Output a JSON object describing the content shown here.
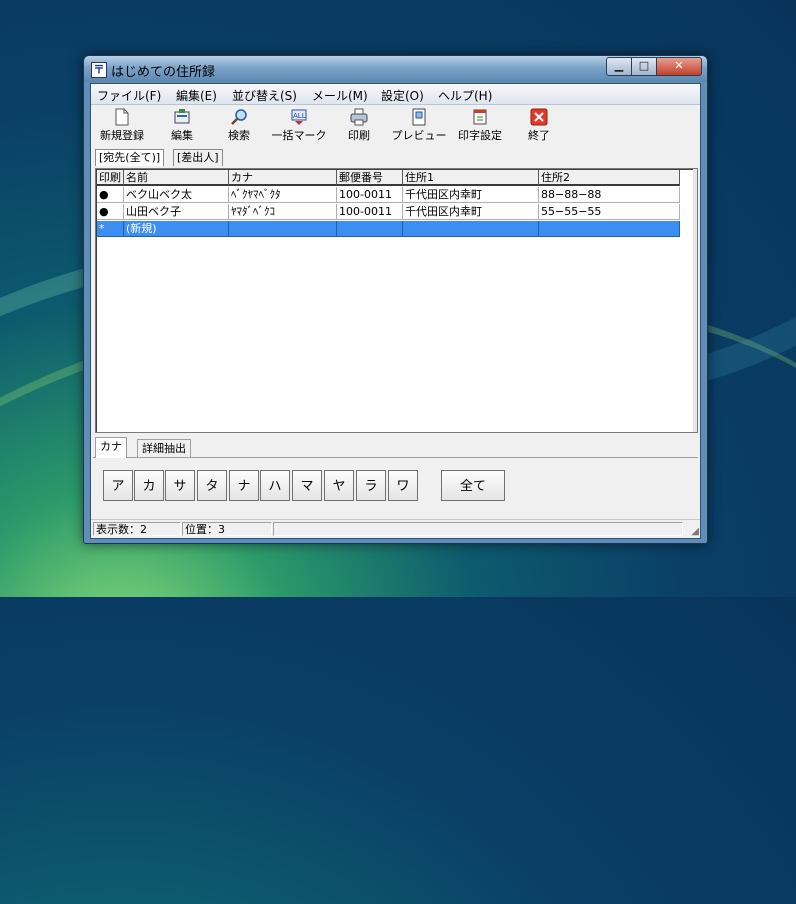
{
  "window": {
    "title": "はじめての住所録",
    "app_icon": "〒",
    "min_glyph": "▁",
    "max_glyph": "□",
    "close_glyph": "✕"
  },
  "menu": [
    "ファイル(F)",
    "編集(E)",
    "並び替え(S)",
    "メール(M)",
    "設定(O)",
    "ヘルプ(H)"
  ],
  "toolbar": [
    {
      "label": "新規登録",
      "icon": "new-document-icon"
    },
    {
      "label": "編集",
      "icon": "edit-card-icon"
    },
    {
      "label": "検索",
      "icon": "magnifier-icon"
    },
    {
      "label": "一括マーク",
      "icon": "bulk-mark-icon"
    },
    {
      "label": "印刷",
      "icon": "printer-icon"
    },
    {
      "label": "プレビュー",
      "icon": "preview-icon"
    },
    {
      "label": "印字設定",
      "icon": "print-settings-icon"
    },
    {
      "label": "終了",
      "icon": "exit-icon"
    }
  ],
  "top_tabs": [
    "[宛先(全て)]",
    "[差出人]"
  ],
  "table": {
    "columns": [
      "印刷",
      "名前",
      "カナ",
      "郵便番号",
      "住所1",
      "住所2"
    ],
    "rows": [
      [
        "●",
        "ベク山ベク太",
        "ﾍﾞｸﾔﾏﾍﾞｸﾀ",
        "100-0011",
        "千代田区内幸町",
        "88−88−88"
      ],
      [
        "●",
        "山田ベク子",
        "ﾔﾏﾀﾞﾍﾞｸｺ",
        "100-0011",
        "千代田区内幸町",
        "55−55−55"
      ]
    ],
    "new_row": [
      "*",
      "(新規)",
      "",
      "",
      "",
      ""
    ],
    "new_row_color": "#3c8ff0"
  },
  "bottom_tabs": [
    "カナ",
    "詳細抽出"
  ],
  "kana_buttons": [
    "ア",
    "カ",
    "サ",
    "タ",
    "ナ",
    "ハ",
    "マ",
    "ヤ",
    "ラ",
    "ワ"
  ],
  "all_button": "全て",
  "status": {
    "count": "表示数：2",
    "position": "位置：3"
  }
}
